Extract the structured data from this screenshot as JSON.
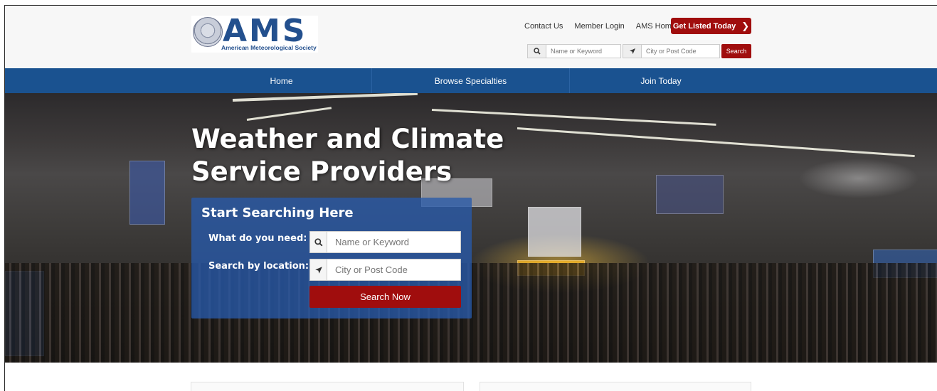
{
  "header": {
    "logo_text": "AMS",
    "logo_subtitle": "American Meteorological Society",
    "links": [
      "Contact Us",
      "Member Login",
      "AMS Home"
    ],
    "cta_label": "Get Listed Today",
    "mini_search": {
      "keyword_placeholder": "Name or Keyword",
      "location_placeholder": "City or Post Code",
      "button_label": "Search"
    }
  },
  "nav": {
    "items": [
      "Home",
      "Browse Specialties",
      "Join Today"
    ]
  },
  "hero": {
    "title_line1": "Weather and Climate",
    "title_line2": "Service Providers",
    "search_panel": {
      "title": "Start Searching Here",
      "label_need": "What do you need:",
      "label_location": "Search by location:",
      "keyword_placeholder": "Name or Keyword",
      "location_placeholder": "City or Post Code",
      "button_label": "Search Now"
    }
  },
  "colors": {
    "brand_blue": "#1a5290",
    "accent_red": "#a00d0d"
  }
}
